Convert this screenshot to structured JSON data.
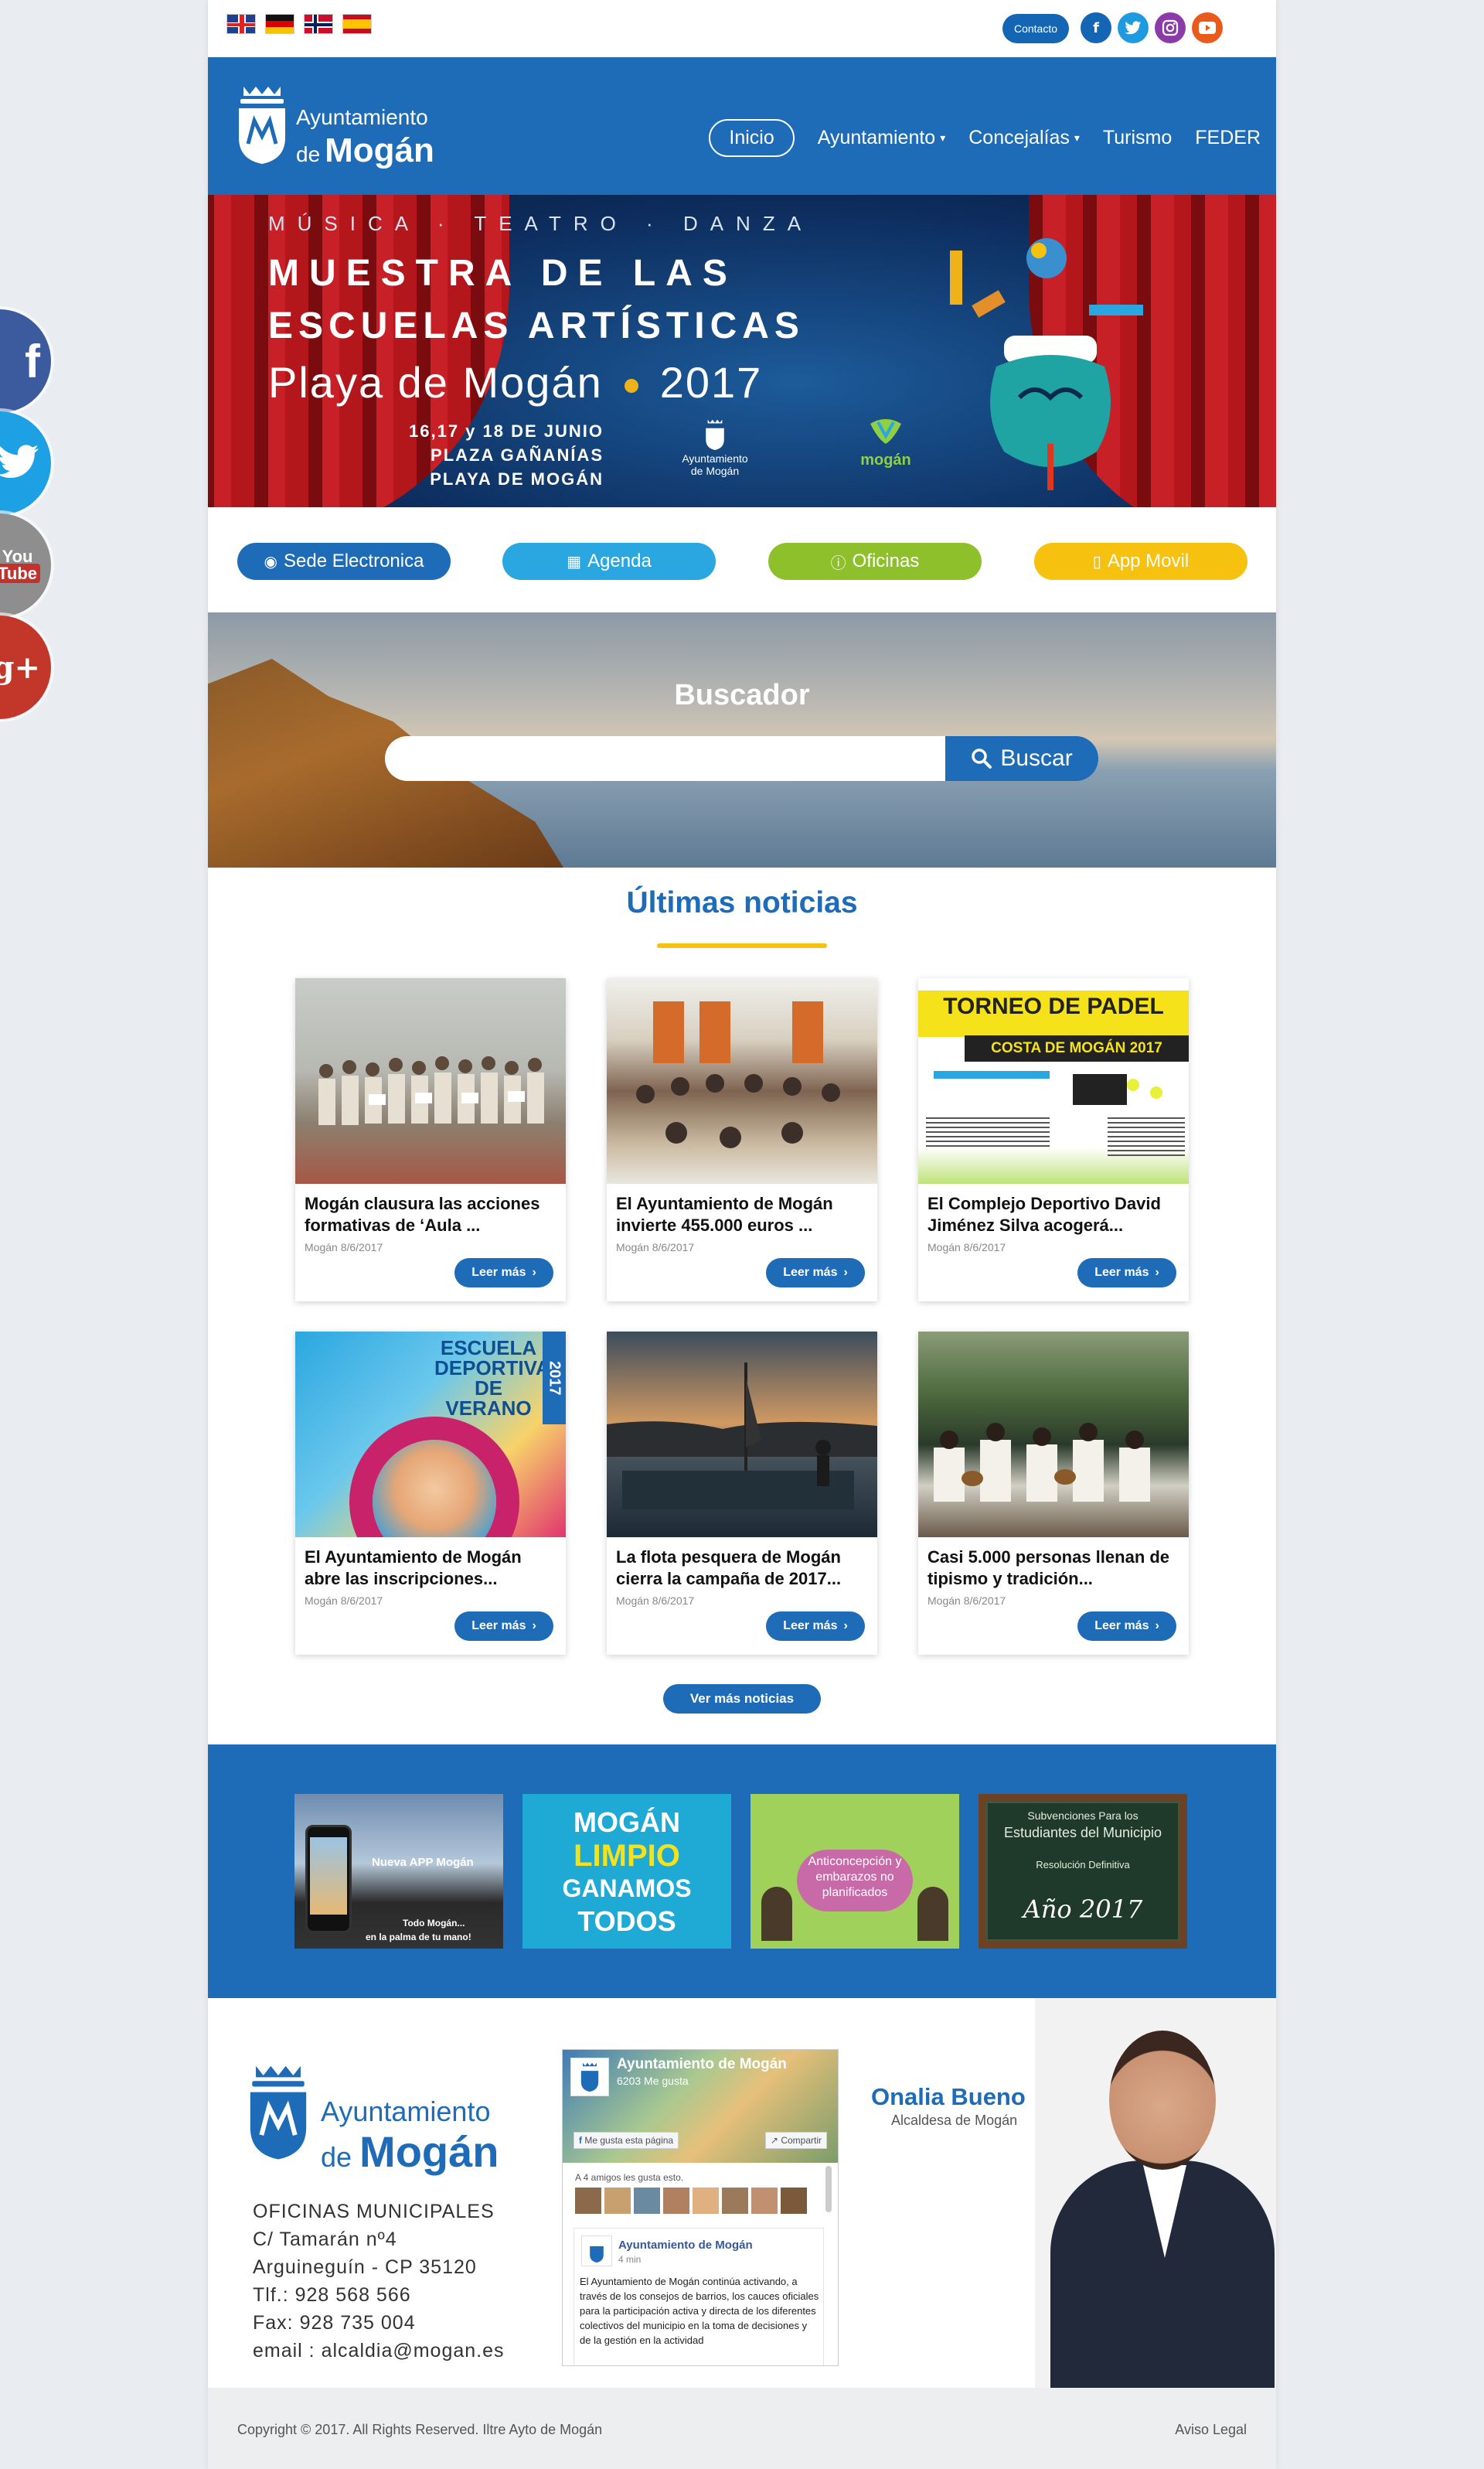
{
  "topbar": {
    "flags": [
      "en",
      "de",
      "no",
      "es"
    ],
    "contact_label": "Contacto",
    "social_icons": [
      "facebook-icon",
      "twitter-icon",
      "instagram-icon",
      "youtube-icon"
    ]
  },
  "header": {
    "logo_line1": "Ayuntamiento",
    "logo_de": "de",
    "logo_line2": "Mogán",
    "nav": [
      {
        "label": "Inicio",
        "active": true
      },
      {
        "label": "Ayuntamiento",
        "dropdown": true
      },
      {
        "label": "Concejalías",
        "dropdown": true
      },
      {
        "label": "Turismo"
      },
      {
        "label": "FEDER"
      }
    ]
  },
  "banner": {
    "subtitle": "MÚSICA · TEATRO · DANZA",
    "title_line1": "MUESTRA DE LAS",
    "title_line2": "ESCUELAS ARTÍSTICAS",
    "title_place": "Playa de Mogán",
    "title_year": "2017",
    "date_line1": "16,17 y 18 DE JUNIO",
    "date_line2": "PLAZA GAÑANÍAS",
    "date_line3": "PLAYA DE MOGÁN",
    "logo_small": "Ayuntamiento de Mogán",
    "logo_mogan": "mogán"
  },
  "quick_links": [
    {
      "label": "Sede Electronica",
      "icon": "rss-icon",
      "color": "#1e6bb8"
    },
    {
      "label": "Agenda",
      "icon": "calendar-icon",
      "color": "#2aa7e0"
    },
    {
      "label": "Oficinas",
      "icon": "info-icon",
      "color": "#8ec02b"
    },
    {
      "label": "App Movil",
      "icon": "mobile-icon",
      "color": "#f6c20f"
    }
  ],
  "search": {
    "title": "Buscador",
    "placeholder": "",
    "button_label": "Buscar"
  },
  "news": {
    "section_title": "Últimas noticias",
    "read_more": "Leer más",
    "items": [
      {
        "title": "Mogán clausura las acciones formativas de ‘Aula ...",
        "date": "Mogán 8/6/2017"
      },
      {
        "title": "El Ayuntamiento de Mogán invierte 455.000 euros ...",
        "date": "Mogán 8/6/2017"
      },
      {
        "title": "El Complejo Deportivo David Jiménez Silva acogerá...",
        "date": "Mogán 8/6/2017"
      },
      {
        "title": "El Ayuntamiento de Mogán abre las inscripciones...",
        "date": "Mogán 8/6/2017"
      },
      {
        "title": "La flota pesquera de Mogán cierra la campaña de 2017...",
        "date": "Mogán 8/6/2017"
      },
      {
        "title": "Casi 5.000 personas llenan de tipismo y tradición...",
        "date": "Mogán 8/6/2017"
      }
    ],
    "more_label": "Ver más noticias",
    "padel_title": "TORNEO DE PADEL",
    "padel_sub": "COSTA DE MOGÁN 2017",
    "escuela_title": "ESCUELA DEPORTIVA DE VERANO",
    "escuela_year": "2017"
  },
  "promos": {
    "app_label": "Nueva APP Mogán",
    "app_tag1": "Todo Mogán...",
    "app_tag2": "en la palma de tu mano!",
    "limpio1": "MOGÁN",
    "limpio2": "LIMPIO",
    "limpio3": "GANAMOS",
    "limpio4": "TODOS",
    "anticon": "Anticoncepción y embarazos no planificados",
    "subv1": "Subvenciones Para los",
    "subv2": "Estudiantes del Municipio",
    "subv3": "Resolución Definitiva",
    "subv4": "Año 2017"
  },
  "footer": {
    "logo_line1": "Ayuntamiento",
    "logo_de": "de",
    "logo_line2": "Mogán",
    "address": [
      "OFICINAS MUNICIPALES",
      "C/ Tamarán nº4",
      "Arguineguín - CP 35120",
      "Tlf.: 928 568 566",
      "Fax: 928 735 004",
      "email : alcaldia@mogan.es"
    ],
    "fb": {
      "name": "Ayuntamiento de Mogán",
      "likes": "6203 Me gusta",
      "like_btn": "Me gusta esta página",
      "share_btn": "Compartir",
      "friends": "A 4 amigos les gusta esto.",
      "post_author": "Ayuntamiento de Mogán",
      "post_time": "4 min",
      "post_text": "El Ayuntamiento de Mogán continúa activando, a través de los consejos de barrios, los cauces oficiales para la participación activa y directa de los diferentes colectivos del municipio en la toma de decisiones y de la gestión en la actividad"
    },
    "mayor_name": "Onalia Bueno",
    "mayor_role": "Alcaldesa de Mogán",
    "copyright": "Copyright © 2017. All Rights Reserved. Iltre Ayto de Mogán",
    "legal": "Aviso Legal"
  },
  "side_social": [
    "facebook-icon",
    "twitter-icon",
    "youtube-icon",
    "google-plus-icon"
  ]
}
